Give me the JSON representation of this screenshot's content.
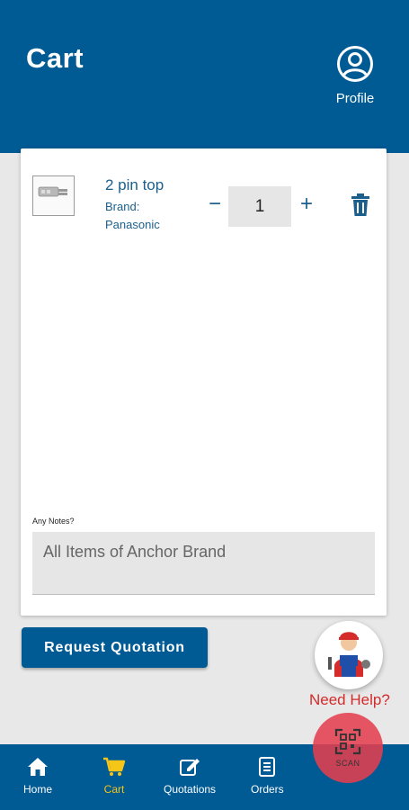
{
  "header": {
    "title": "Cart",
    "profile_label": "Profile"
  },
  "cart": {
    "items": [
      {
        "name": "2 pin top",
        "brand_label": "Brand:",
        "brand": "Panasonic",
        "quantity": "1"
      }
    ],
    "minus_symbol": "−",
    "plus_symbol": "+",
    "notes_label": "Any Notes?",
    "notes_value": "All Items of Anchor Brand"
  },
  "actions": {
    "request_quotation": "Request Quotation",
    "need_help": "Need Help?",
    "scan": "SCAN"
  },
  "nav": {
    "items": [
      {
        "label": "Home",
        "icon": "home-icon",
        "active": false
      },
      {
        "label": "Cart",
        "icon": "cart-icon",
        "active": true
      },
      {
        "label": "Quotations",
        "icon": "quotations-icon",
        "active": false
      },
      {
        "label": "Orders",
        "icon": "orders-icon",
        "active": false
      }
    ]
  },
  "colors": {
    "primary": "#005a94",
    "accent_active": "#f5c518",
    "link_text": "#1b5f8c",
    "help_red": "#d42b2b",
    "scan_button": "#e43f4e"
  }
}
